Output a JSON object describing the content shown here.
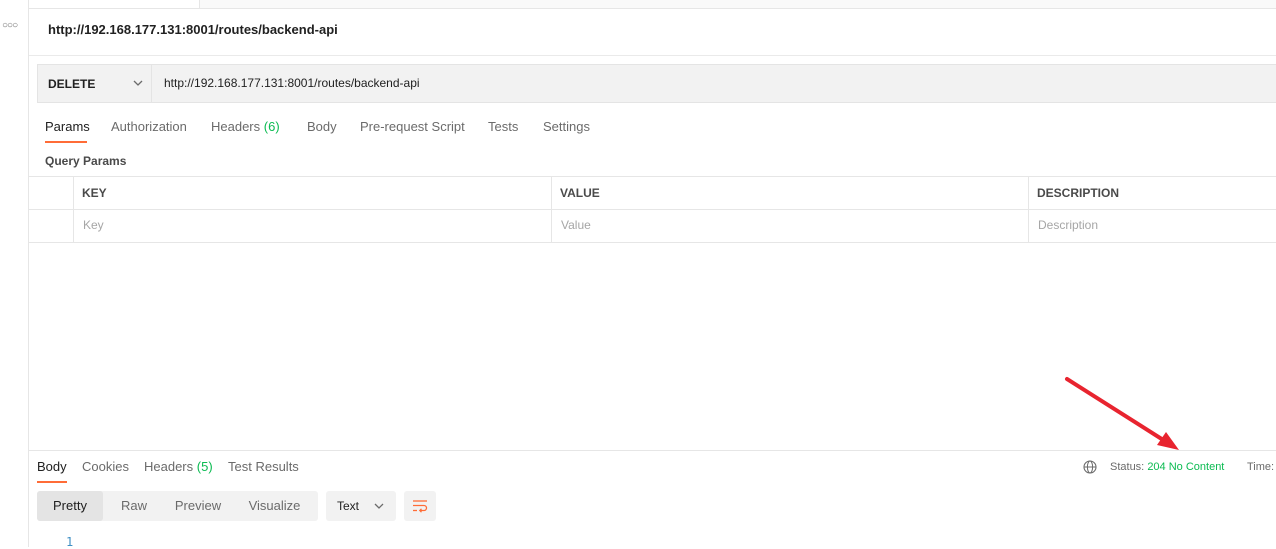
{
  "app": {
    "tab_title": "http://192.168.177.131:8001/routes/backend-api",
    "side_icon": "more-dots-icon"
  },
  "request": {
    "method": "DELETE",
    "url": "http://192.168.177.131:8001/routes/backend-api"
  },
  "request_tabs": [
    {
      "label": "Params",
      "count": "",
      "active": true
    },
    {
      "label": "Authorization",
      "count": ""
    },
    {
      "label": "Headers",
      "count": "(6)"
    },
    {
      "label": "Body",
      "count": ""
    },
    {
      "label": "Pre-request Script",
      "count": ""
    },
    {
      "label": "Tests",
      "count": ""
    },
    {
      "label": "Settings",
      "count": ""
    }
  ],
  "query_params": {
    "title": "Query Params",
    "columns": [
      "KEY",
      "VALUE",
      "DESCRIPTION"
    ],
    "placeholders": [
      "Key",
      "Value",
      "Description"
    ]
  },
  "response": {
    "tabs": [
      {
        "label": "Body",
        "count": "",
        "active": true
      },
      {
        "label": "Cookies",
        "count": ""
      },
      {
        "label": "Headers",
        "count": "(5)"
      },
      {
        "label": "Test Results",
        "count": ""
      }
    ],
    "status_label": "Status:",
    "status_value": "204 No Content",
    "time_label": "Time:",
    "view_modes": [
      "Pretty",
      "Raw",
      "Preview",
      "Visualize"
    ],
    "active_view_mode": "Pretty",
    "format": "Text",
    "line_numbers": [
      "1"
    ]
  },
  "colors": {
    "accent": "#ff6c37",
    "success": "#0cbb52",
    "annotation_arrow": "#e8242f"
  }
}
